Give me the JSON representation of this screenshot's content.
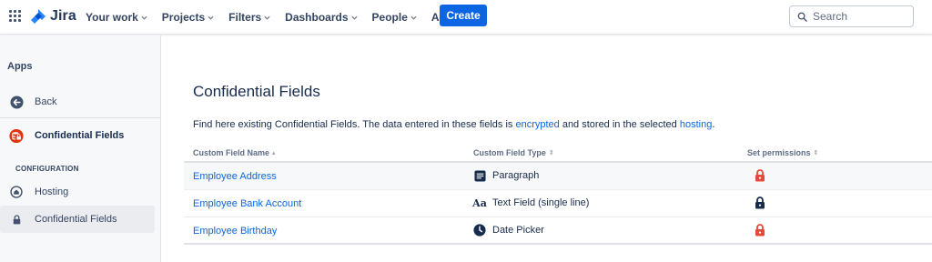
{
  "topbar": {
    "product": "Jira",
    "nav": [
      {
        "label": "Your work",
        "has_dropdown": true
      },
      {
        "label": "Projects",
        "has_dropdown": true
      },
      {
        "label": "Filters",
        "has_dropdown": true
      },
      {
        "label": "Dashboards",
        "has_dropdown": true
      },
      {
        "label": "People",
        "has_dropdown": true
      },
      {
        "label": "Apps",
        "has_dropdown": true
      }
    ],
    "create_label": "Create",
    "search_placeholder": "Search"
  },
  "sidebar": {
    "heading": "Apps",
    "back_label": "Back",
    "app_label": "Confidential Fields",
    "section_label": "CONFIGURATION",
    "items": [
      {
        "label": "Hosting",
        "icon": "home-icon",
        "selected": false
      },
      {
        "label": "Confidential Fields",
        "icon": "lock-icon",
        "selected": true
      }
    ]
  },
  "main": {
    "title": "Confidential Fields",
    "description_prefix": "Find here existing Confidential Fields. The data entered in these fields is ",
    "description_link1": "encrypted",
    "description_middle": " and stored in the selected ",
    "description_link2": "hosting",
    "description_suffix": ".",
    "table": {
      "columns": [
        {
          "label": "Custom Field Name",
          "sort": "▴"
        },
        {
          "label": "Custom Field Type",
          "sort": "⇕"
        },
        {
          "label": "Set permissions",
          "sort": "⇕"
        }
      ],
      "rows": [
        {
          "name": "Employee Address",
          "type": "Paragraph",
          "type_icon": "paragraph-icon",
          "permission": "restricted"
        },
        {
          "name": "Employee Bank Account",
          "type": "Text Field (single line)",
          "type_icon": "text-field-icon",
          "type_icon_text": "Aa",
          "permission": "locked"
        },
        {
          "name": "Employee Birthday",
          "type": "Date Picker",
          "type_icon": "clock-icon",
          "permission": "restricted"
        }
      ]
    }
  },
  "colors": {
    "accent": "#0c66e4",
    "lock_orange": "#e5493a",
    "lock_dark": "#172b4d",
    "app_icon_red": "#de350b"
  }
}
